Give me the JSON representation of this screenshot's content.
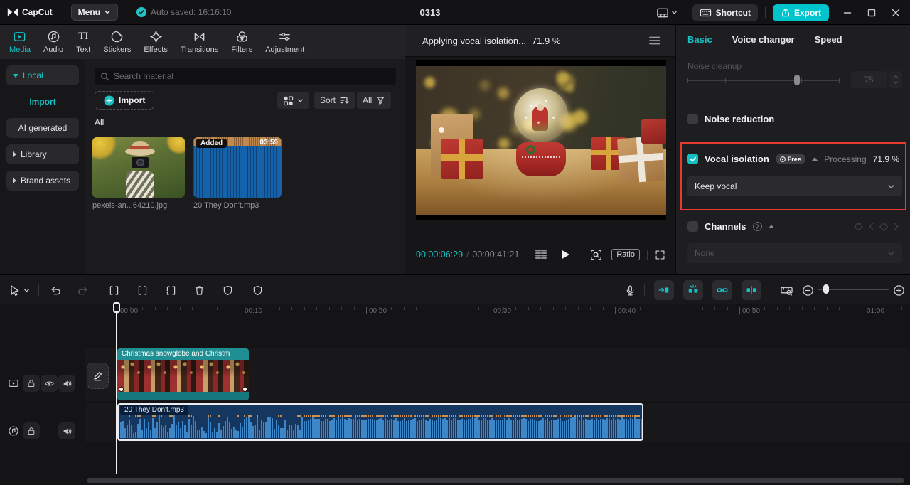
{
  "colors": {
    "accent": "#16c2c4",
    "export_bg": "#00c4cc",
    "highlight_red": "#e83b30",
    "clip_teal": "#1f8f93",
    "audio_clip_blue": "#14365f"
  },
  "topbar": {
    "app_name": "CapCut",
    "menu_label": "Menu",
    "autosave_text": "Auto saved: 16:16:10",
    "project_title": "0313",
    "shortcut_label": "Shortcut",
    "export_label": "Export"
  },
  "media_panel": {
    "tabs": [
      {
        "label": "Media"
      },
      {
        "label": "Audio"
      },
      {
        "label": "Text",
        "icon_text": "TI"
      },
      {
        "label": "Stickers"
      },
      {
        "label": "Effects"
      },
      {
        "label": "Transitions"
      },
      {
        "label": "Filters"
      },
      {
        "label": "Adjustment"
      }
    ],
    "sidebar": [
      {
        "label": "Local"
      },
      {
        "label": "Import"
      },
      {
        "label": "AI generated"
      },
      {
        "label": "Library"
      },
      {
        "label": "Brand assets"
      }
    ],
    "search_placeholder": "Search material",
    "import_button": "Import",
    "sort_label": "Sort",
    "filter_label": "All",
    "section_title": "All",
    "items": [
      {
        "label": "pexels-an...64210.jpg",
        "type": "image"
      },
      {
        "label": "20 They Don't.mp3",
        "type": "audio",
        "badge": "Added",
        "duration": "03:59"
      }
    ]
  },
  "player": {
    "toast_text": "Applying vocal isolation...",
    "toast_progress": "71.9 %",
    "current_time": "00:00:06:29",
    "time_separator": "/",
    "duration": "00:00:41:21",
    "ratio_label": "Ratio"
  },
  "inspector": {
    "tabs": [
      {
        "label": "Basic"
      },
      {
        "label": "Voice changer"
      },
      {
        "label": "Speed"
      }
    ],
    "noise_cleanup": {
      "label": "Noise cleanup",
      "value": "75"
    },
    "noise_reduction": {
      "label": "Noise reduction"
    },
    "vocal_isolation": {
      "label": "Vocal isolation",
      "badge": "Free",
      "status": "Processing",
      "progress": "71.9 %",
      "selection": "Keep vocal"
    },
    "channels": {
      "label": "Channels",
      "selection": "None"
    }
  },
  "timeline": {
    "ruler_labels": [
      "00:00",
      "00:10",
      "00:20",
      "00:30",
      "00:40",
      "00:50",
      "01:00"
    ],
    "video_clip_label": "Christmas snowglobe and Christm",
    "audio_clip_label": "20 They Don't.mp3"
  }
}
